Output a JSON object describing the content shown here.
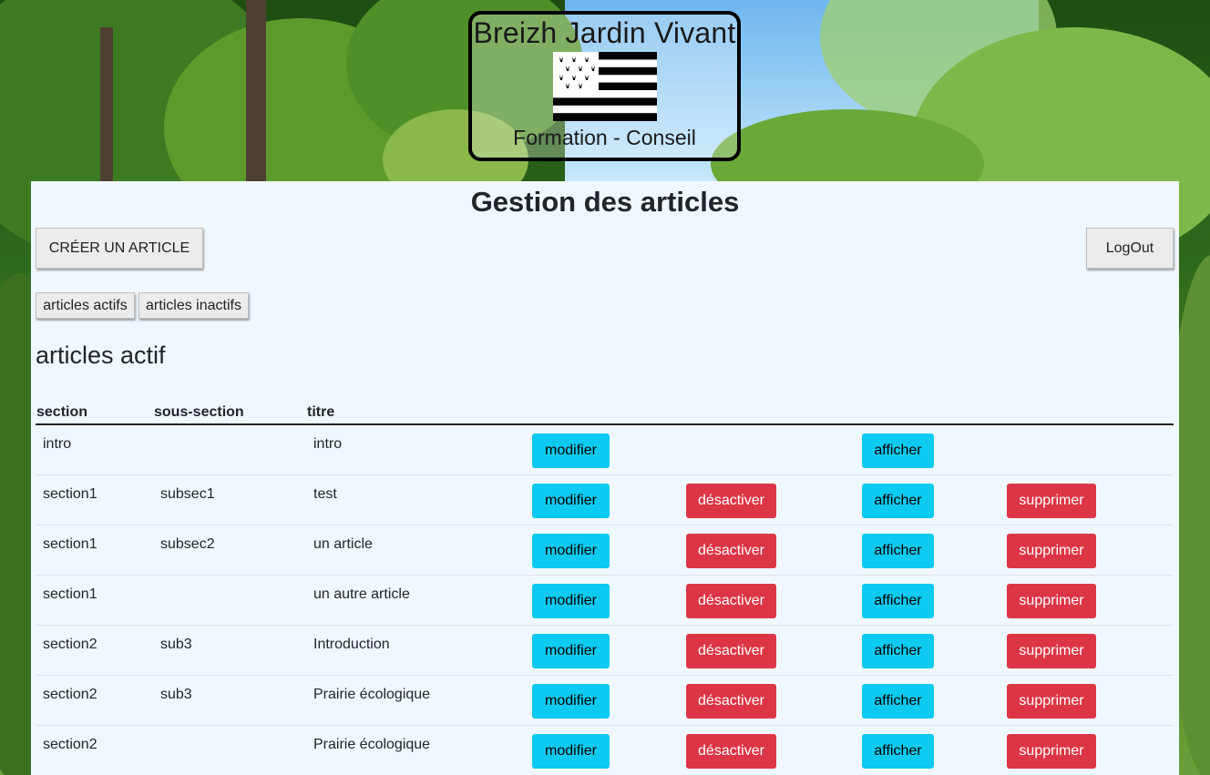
{
  "logo": {
    "title": "Breizh Jardin Vivant",
    "subtitle": "Formation - Conseil"
  },
  "page": {
    "title": "Gestion des articles",
    "create_button": "CRÉER UN ARTICLE",
    "logout_button": "LogOut",
    "tabs": [
      "articles actifs",
      "articles inactifs"
    ],
    "section_title": "articles actif"
  },
  "table": {
    "headers": [
      "section",
      "sous-section",
      "titre"
    ],
    "rows": [
      {
        "section": "intro",
        "subsection": "",
        "title": "intro",
        "has_disable": false
      },
      {
        "section": "section1",
        "subsection": "subsec1",
        "title": "test",
        "has_disable": true
      },
      {
        "section": "section1",
        "subsection": "subsec2",
        "title": "un article",
        "has_disable": true
      },
      {
        "section": "section1",
        "subsection": "",
        "title": "un autre article",
        "has_disable": true
      },
      {
        "section": "section2",
        "subsection": "sub3",
        "title": "Introduction",
        "has_disable": true
      },
      {
        "section": "section2",
        "subsection": "sub3",
        "title": "Prairie écologique",
        "has_disable": true
      },
      {
        "section": "section2",
        "subsection": "",
        "title": "Prairie écologique",
        "has_disable": true
      }
    ],
    "actions": {
      "edit": "modifier",
      "disable": "désactiver",
      "show": "afficher",
      "delete": "supprimer"
    }
  },
  "colors": {
    "panel_bg": "#f0f8ff",
    "info": "#0dcaf0",
    "danger": "#dc3545"
  }
}
